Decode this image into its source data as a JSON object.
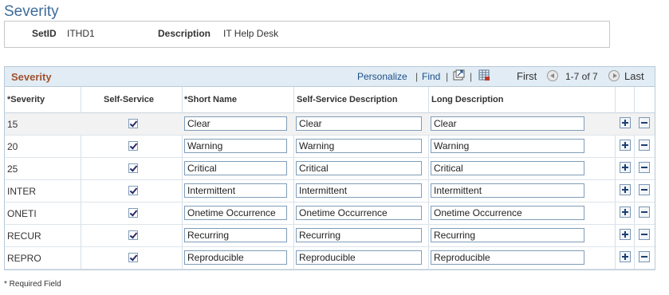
{
  "page": {
    "title": "Severity"
  },
  "key": {
    "setid_label": "SetID",
    "setid_value": "ITHD1",
    "description_label": "Description",
    "description_value": "IT Help Desk"
  },
  "grid": {
    "title": "Severity",
    "personalize": "Personalize",
    "sep1": "|",
    "find": "Find",
    "sep2": "|",
    "sep3": "|",
    "first": "First",
    "range": "1-7 of 7",
    "last": "Last",
    "icons": [
      "view-all-icon",
      "download-excel-icon",
      "previous-icon",
      "next-icon",
      "add-row-icon",
      "delete-row-icon"
    ],
    "columns": [
      "*Severity",
      "Self-Service",
      "*Short Name",
      "Self-Service Description",
      "Long Description"
    ],
    "rows": [
      {
        "severity": "15",
        "self_service": true,
        "short_name": "Clear",
        "ss_desc": "Clear",
        "long_desc": "Clear"
      },
      {
        "severity": "20",
        "self_service": true,
        "short_name": "Warning",
        "ss_desc": "Warning",
        "long_desc": "Warning"
      },
      {
        "severity": "25",
        "self_service": true,
        "short_name": "Critical",
        "ss_desc": "Critical",
        "long_desc": "Critical"
      },
      {
        "severity": "INTER",
        "self_service": true,
        "short_name": "Intermittent",
        "ss_desc": "Intermittent",
        "long_desc": "Intermittent"
      },
      {
        "severity": "ONETI",
        "self_service": true,
        "short_name": "Onetime Occurrence",
        "ss_desc": "Onetime Occurrence",
        "long_desc": "Onetime Occurrence"
      },
      {
        "severity": "RECUR",
        "self_service": true,
        "short_name": "Recurring",
        "ss_desc": "Recurring",
        "long_desc": "Recurring"
      },
      {
        "severity": "REPRO",
        "self_service": true,
        "short_name": "Reproducible",
        "ss_desc": "Reproducible",
        "long_desc": "Reproducible"
      }
    ]
  },
  "footer": {
    "required_note": "* Required Field"
  },
  "colors": {
    "title": "#3d6d9a",
    "grid_title": "#a0522d",
    "link": "#1d4f8a",
    "header_bg": "#e1ecf4"
  }
}
